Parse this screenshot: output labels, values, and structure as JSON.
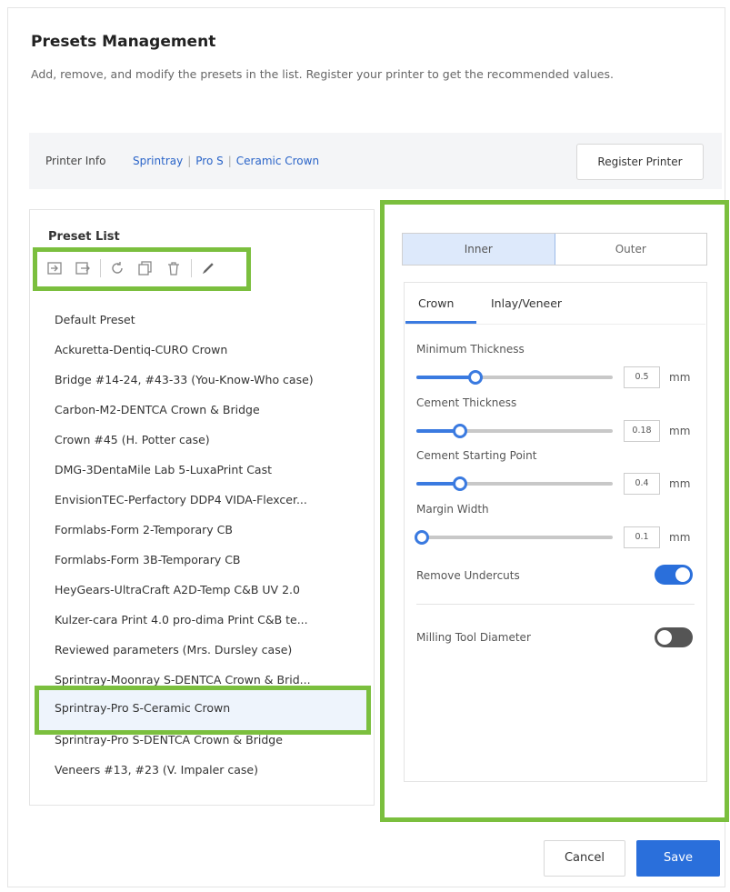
{
  "dialog": {
    "title": "Presets Management",
    "description": "Add, remove, and modify the presets in the list. Register your printer to get the recommended values."
  },
  "printer_info": {
    "label": "Printer Info",
    "manufacturer": "Sprintray",
    "model": "Pro S",
    "material": "Ceramic Crown",
    "register_label": "Register Printer"
  },
  "preset_list": {
    "title": "Preset List",
    "toolbar_icons": [
      "import-icon",
      "export-icon",
      "reset-icon",
      "duplicate-icon",
      "delete-icon",
      "edit-icon"
    ],
    "items": [
      "Default Preset",
      "Ackuretta-Dentiq-CURO Crown",
      "Bridge #14-24, #43-33 (You-Know-Who case)",
      "Carbon-M2-DENTCA Crown & Bridge",
      "Crown #45 (H. Potter case)",
      "DMG-3DentaMile Lab 5-LuxaPrint Cast",
      "EnvisionTEC-Perfactory DDP4 VIDA-Flexcer...",
      "Formlabs-Form 2-Temporary CB",
      "Formlabs-Form 3B-Temporary CB",
      "HeyGears-UltraCraft A2D-Temp C&B UV 2.0",
      "Kulzer-cara Print 4.0 pro-dima Print C&B te...",
      "Reviewed parameters (Mrs. Dursley case)",
      "Sprintray-Moonray S-DENTCA Crown & Brid...",
      "Sprintray-Pro S-Ceramic Crown",
      "Sprintray-Pro S-DENTCA Crown & Bridge",
      "Veneers #13, #23 (V. Impaler case)"
    ],
    "selected_index": 13
  },
  "settings": {
    "segments": [
      "Inner",
      "Outer"
    ],
    "active_segment": "Inner",
    "subtabs": [
      "Crown",
      "Inlay/Veneer"
    ],
    "active_subtab": "Crown",
    "sliders": [
      {
        "label": "Minimum Thickness",
        "value": "0.5",
        "unit": "mm",
        "fraction": 0.3
      },
      {
        "label": "Cement Thickness",
        "value": "0.18",
        "unit": "mm",
        "fraction": 0.22
      },
      {
        "label": "Cement Starting Point",
        "value": "0.4",
        "unit": "mm",
        "fraction": 0.22
      },
      {
        "label": "Margin Width",
        "value": "0.1",
        "unit": "mm",
        "fraction": 0.03
      }
    ],
    "toggles": [
      {
        "label": "Remove Undercuts",
        "on": true
      },
      {
        "label": "Milling Tool Diameter",
        "on": false
      }
    ]
  },
  "footer": {
    "cancel_label": "Cancel",
    "save_label": "Save"
  },
  "colors": {
    "accent": "#2a6fdb",
    "highlight": "#7bbf3e",
    "selected_row": "#eef4fc"
  }
}
